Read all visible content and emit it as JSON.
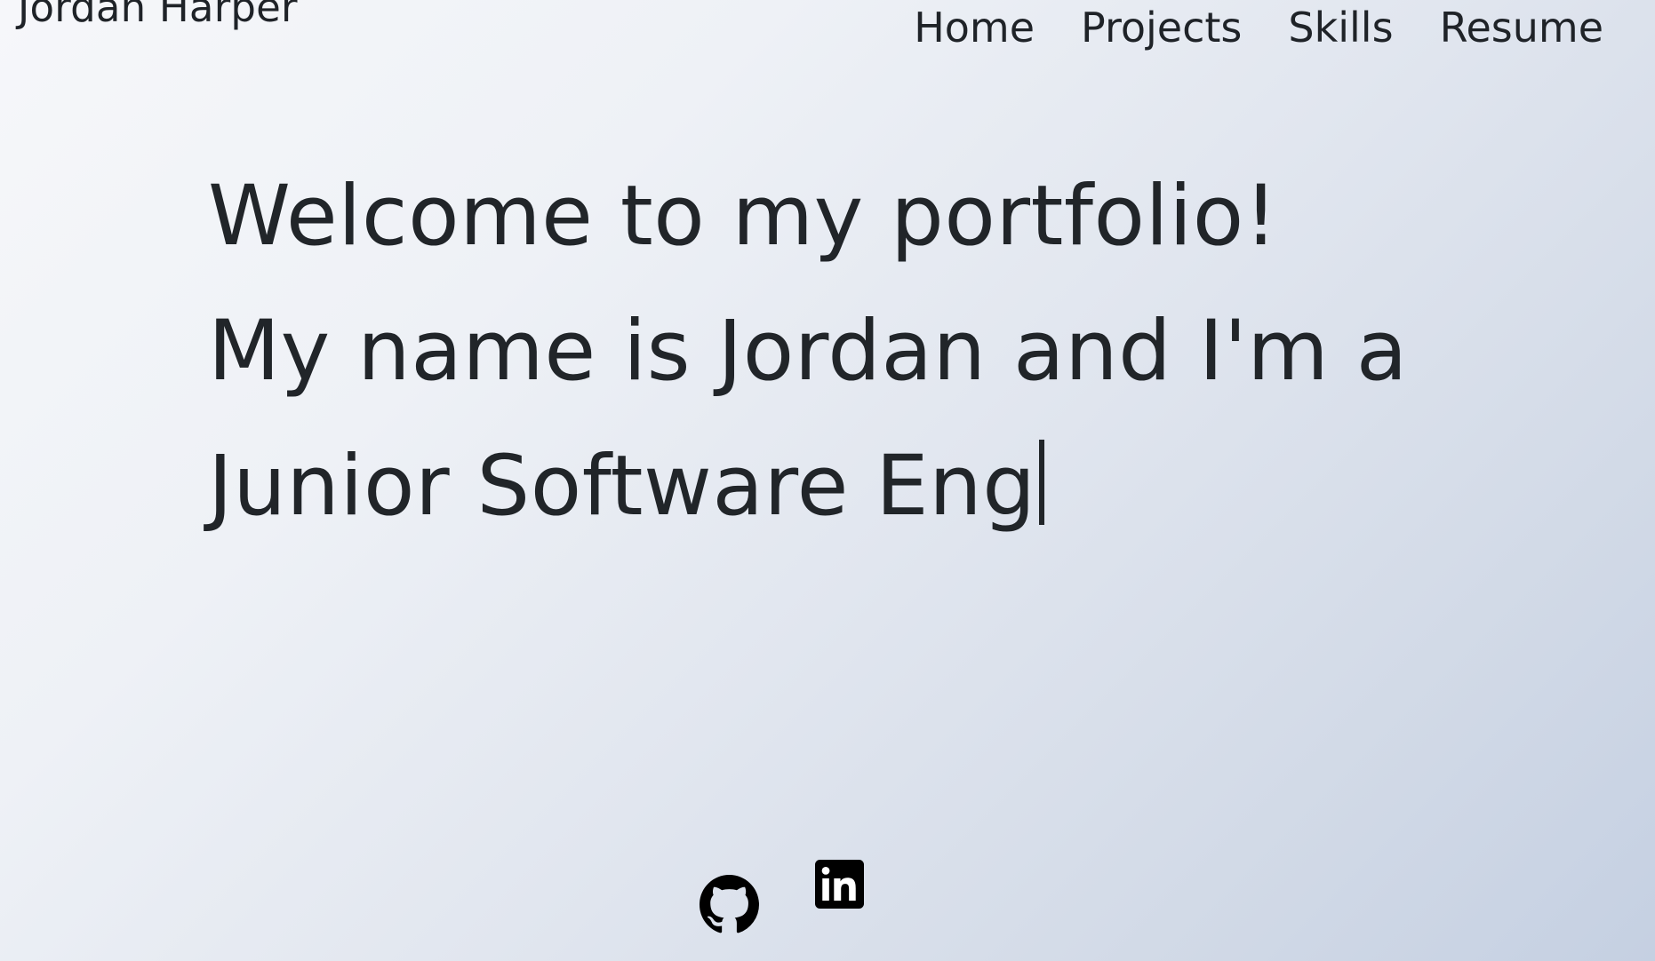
{
  "header": {
    "brand": "Jordan Harper",
    "nav": [
      "Home",
      "Projects",
      "Skills",
      "Resume"
    ]
  },
  "hero": {
    "typed_text": "Welcome to my portfolio! My name is Jordan and I'm a Junior Software Eng"
  },
  "social": [
    {
      "icon": "github-icon",
      "color": "#000000"
    },
    {
      "icon": "linkedin-icon",
      "color": "#000000"
    }
  ],
  "colors": {
    "text": "#212529",
    "background_start": "#f6f7fa",
    "background_end": "#c5d0e2"
  }
}
